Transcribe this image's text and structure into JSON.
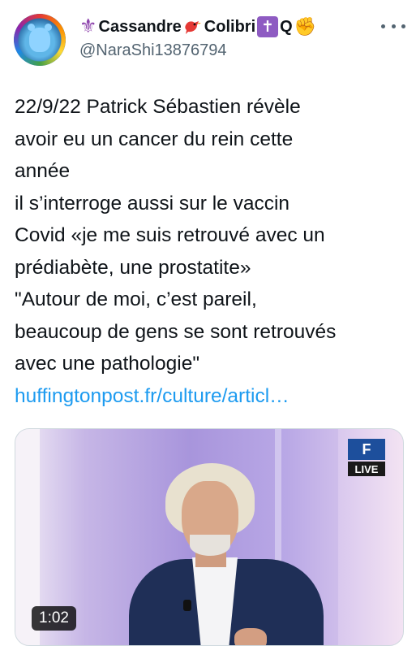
{
  "author": {
    "display_name": "Cassandre",
    "display_name_part2": "Colibri",
    "display_name_part3": "Q",
    "handle": "@NaraShi13876794",
    "avatar_icon": "rainbow-bear-avatar"
  },
  "icons": {
    "fleur": "fleur-de-lis-icon",
    "bird": "red-bird-icon",
    "cross": "latin-cross-icon",
    "hand": "raised-fist-icon",
    "more": "more-options-icon",
    "channel": "tf1-info-logo"
  },
  "tweet": {
    "lines": [
      "22/9/22 Patrick Sébastien révèle",
      "avoir eu un cancer du rein cette",
      "année",
      "il s’interroge aussi sur le vaccin",
      "Covid «je me suis retrouvé avec un",
      "prédiabète, une prostatite»",
      "\"Autour de moi, c’est pareil,",
      "beaucoup de gens se sont retrouvés",
      "avec une pathologie\""
    ],
    "link": "huffingtonpost.fr/culture/articl…"
  },
  "media": {
    "channel_logo": "F",
    "live_label": "LIVE",
    "duration": "1:02"
  },
  "colors": {
    "text": "#0f1419",
    "secondary": "#536471",
    "link": "#1d9bf0"
  }
}
